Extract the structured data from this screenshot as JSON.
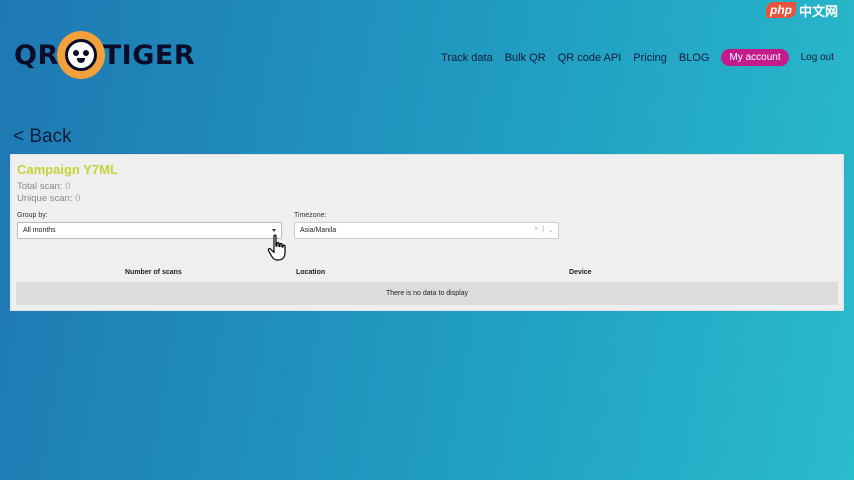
{
  "watermark": {
    "brand": "php",
    "site": "中文网"
  },
  "logo": {
    "left": "QR",
    "right": "TIGER"
  },
  "nav": {
    "items": [
      "Track data",
      "Bulk QR",
      "QR code API",
      "Pricing",
      "BLOG"
    ],
    "my_account": "My account",
    "logout": "Log out"
  },
  "back_label": "< Back",
  "campaign": {
    "title": "Campaign Y7ML",
    "total_scan_label": "Total scan:",
    "total_scan_value": "0",
    "unique_scan_label": "Unique scan:",
    "unique_scan_value": "0"
  },
  "filters": {
    "group_by_label": "Group by:",
    "group_by_value": "All months",
    "timezone_label": "Timezone:",
    "timezone_value": "Asia/Manila",
    "clear_glyph": "×",
    "separator_glyph": "|",
    "dropdown_glyph": "⌄"
  },
  "table": {
    "headers": [
      "Number of scans",
      "Location",
      "Device"
    ],
    "empty_message": "There is no data to display"
  },
  "colors": {
    "accent_title": "#c6d33b",
    "my_account_bg": "#c41b8c",
    "logo_orange": "#f3a23b"
  }
}
